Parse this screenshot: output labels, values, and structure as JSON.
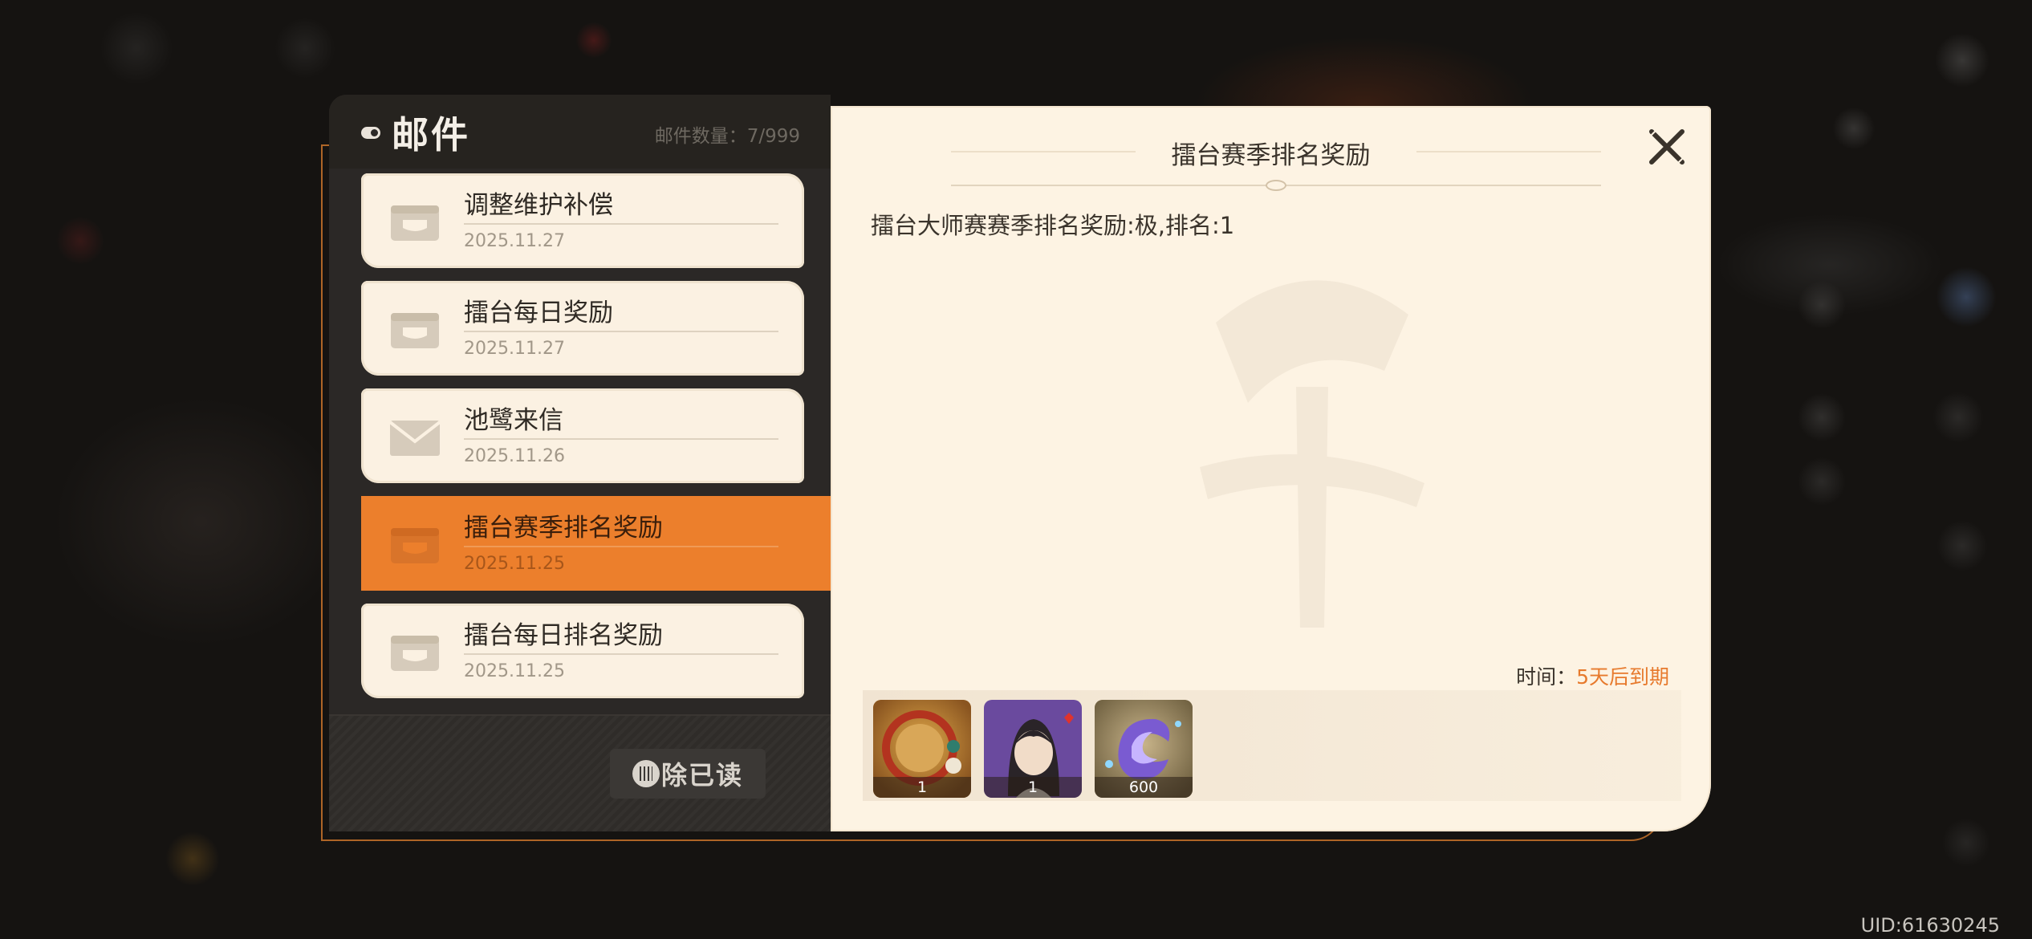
{
  "mailbox": {
    "title": "邮件",
    "count_label": "邮件数量：7/999"
  },
  "mails": [
    {
      "subject": "调整维护补偿",
      "date": "2025.11.27",
      "icon": "chest-icon",
      "active": false
    },
    {
      "subject": "擂台每日奖励",
      "date": "2025.11.27",
      "icon": "chest-icon",
      "active": false
    },
    {
      "subject": "池鹭来信",
      "date": "2025.11.26",
      "icon": "envelope-icon",
      "active": false
    },
    {
      "subject": "擂台赛季排名奖励",
      "date": "2025.11.25",
      "icon": "chest-icon",
      "active": true
    },
    {
      "subject": "擂台每日排名奖励",
      "date": "2025.11.25",
      "icon": "chest-icon",
      "active": false
    }
  ],
  "actions": {
    "clear_read_label": "除已读"
  },
  "detail": {
    "title": "擂台赛季排名奖励",
    "body": "擂台大师赛赛季排名奖励:极,排名:1",
    "time_label": "时间：",
    "time_value": "5天后到期",
    "rewards": [
      {
        "icon": "avatar-frame-icon",
        "count": "1"
      },
      {
        "icon": "character-portrait-icon",
        "count": "1"
      },
      {
        "icon": "crystal-currency-icon",
        "count": "600"
      }
    ]
  },
  "footer": {
    "uid": "UID:61630245"
  },
  "colors": {
    "accent": "#ec7f2c",
    "panel_dark": "#2b2826",
    "panel_light": "#fdf3e3"
  }
}
